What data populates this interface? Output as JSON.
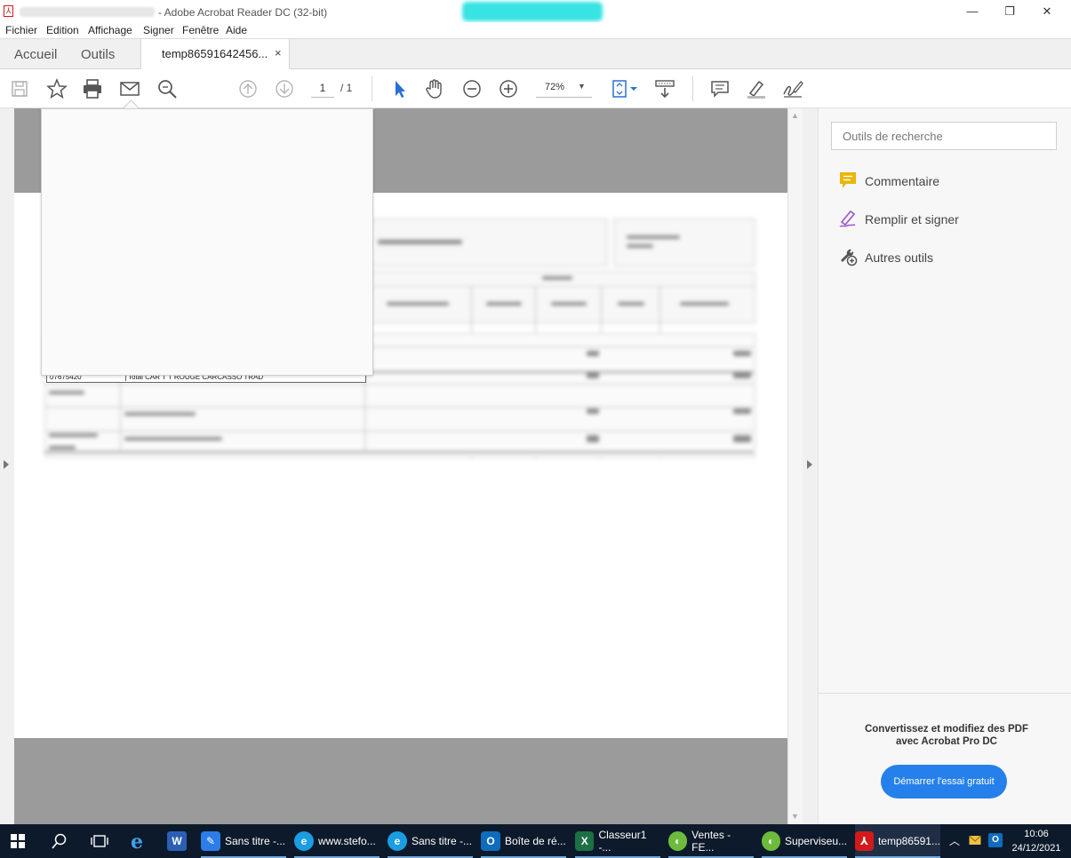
{
  "window": {
    "title": "- Adobe Acrobat Reader DC (32-bit)",
    "controls": {
      "minimize": "—",
      "restore": "❐",
      "close": "✕"
    }
  },
  "menu": [
    "Fichier",
    "Edition",
    "Affichage",
    "Signer",
    "Fenêtre",
    "Aide"
  ],
  "tabs": {
    "home": "Accueil",
    "tools": "Outils",
    "document": "temp86591642456...",
    "close_glyph": "×"
  },
  "toolbar": {
    "page_current": "1",
    "page_total": "/ 1",
    "zoom": "72%",
    "icons": [
      "save-icon",
      "star-icon",
      "print-icon",
      "email-icon",
      "search-zoom-icon",
      "page-up-icon",
      "page-down-icon",
      "select-cursor-icon",
      "hand-icon",
      "zoom-out-icon",
      "zoom-in-icon",
      "fit-page-icon",
      "scroll-mode-icon",
      "comment-icon",
      "highlight-pen-icon",
      "sign-icon"
    ]
  },
  "document": {
    "visible_row_code": "07675420",
    "visible_row_desc": "Total CAR T T ROUGE CARCASSO TRAD"
  },
  "right_panel": {
    "search_placeholder": "Outils de recherche",
    "tools": [
      {
        "label": "Commentaire",
        "icon": "comment-icon",
        "color": "#e8b70a"
      },
      {
        "label": "Remplir et signer",
        "icon": "fill-sign-icon",
        "color": "#9b59d0"
      },
      {
        "label": "Autres outils",
        "icon": "more-tools-icon",
        "color": "#555555"
      }
    ],
    "promo_line1": "Convertissez et modifiez des PDF",
    "promo_line2": "avec Acrobat Pro DC",
    "trial_button": "Démarrer l'essai gratuit",
    "accent": "#2680eb"
  },
  "taskbar": {
    "apps": [
      {
        "label": "Sans titre -...",
        "icon": "paint-icon",
        "color": "#2b7de9"
      },
      {
        "label": "www.stefo...",
        "icon": "edge-icon",
        "color": "#1b9de2"
      },
      {
        "label": "Sans titre -...",
        "icon": "edge-icon",
        "color": "#1b9de2"
      },
      {
        "label": "Boîte de ré...",
        "icon": "outlook-icon",
        "color": "#0f6cbd"
      },
      {
        "label": "Classeur1 -...",
        "icon": "excel-icon",
        "color": "#1d7044"
      },
      {
        "label": "Ventes - FE...",
        "icon": "app-green-icon",
        "color": "#6cbb3c"
      },
      {
        "label": "Superviseu...",
        "icon": "app-green-icon",
        "color": "#6cbb3c"
      },
      {
        "label": "temp86591...",
        "icon": "acrobat-icon",
        "color": "#d21a1a"
      }
    ],
    "time": "10:06",
    "date": "24/12/2021"
  }
}
